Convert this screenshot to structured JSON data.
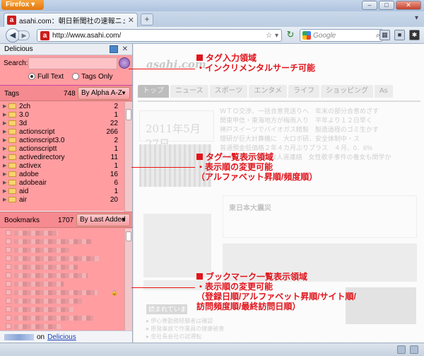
{
  "browser": {
    "menu_label": "Firefox",
    "tab_title": "asahi.com：朝日新聞社の速報ニュースサ...",
    "tab_favicon": "a",
    "new_tab": "+",
    "url": "http://www.asahi.com/",
    "search_placeholder": "Google",
    "window_buttons": [
      "–",
      "□",
      "✕"
    ]
  },
  "sidebar": {
    "title": "Delicious",
    "search": {
      "label": "Search:",
      "value": "",
      "options": [
        "Full Text",
        "Tags Only"
      ],
      "selected": "Full Text"
    },
    "tags": {
      "title": "Tags",
      "count": "748",
      "sort": "By Alpha A-Z",
      "items": [
        {
          "name": "2ch",
          "count": "2"
        },
        {
          "name": "3.0",
          "count": "1"
        },
        {
          "name": "3d",
          "count": "22"
        },
        {
          "name": "actionscript",
          "count": "266"
        },
        {
          "name": "actionscript3.0",
          "count": "2"
        },
        {
          "name": "actionscriptt",
          "count": "1"
        },
        {
          "name": "activedirectory",
          "count": "11"
        },
        {
          "name": "activex",
          "count": "1"
        },
        {
          "name": "adobe",
          "count": "16"
        },
        {
          "name": "adobeair",
          "count": "6"
        },
        {
          "name": "aid",
          "count": "1"
        },
        {
          "name": "air",
          "count": "20"
        }
      ]
    },
    "bookmarks": {
      "title": "Bookmarks",
      "count": "1707",
      "sort": "By Last Added",
      "row_widths": [
        62,
        110,
        78,
        120,
        90,
        104,
        70,
        118,
        96,
        84,
        112,
        66
      ]
    },
    "footer": {
      "on_text": "on",
      "link": "Delicious"
    }
  },
  "page": {
    "logo": "asahi.com",
    "nav": [
      "トップ",
      "ニュース",
      "スポーツ",
      "エンタメ",
      "ライフ",
      "ショッピング",
      "As"
    ],
    "date": "2011年5月27日",
    "headlines": [
      "ＷＴＯ交渉、一括合意見送りへ　年末の部分合意めざす",
      "関東甲信・東海地方が梅雨入り　平年より１２日早く",
      "神戸スイーツでバイオガス精製　製造過程のゴミ生かす",
      "理研が巨大計算機に　大ロボ研、安全体制中・ス",
      "普通預金低価格２年４カ月ぶりプラス　４月、0．6%",
      "アメリカの大規模な人道連絡　女性歌手事件の養女も関学か"
    ],
    "region_head": "東日本大震災",
    "bottom_label": "読まれています",
    "bottom_lines": [
      "▸ 伊心寮勤務経験者は確認",
      "▸ 原発事故で作業員の健康被害",
      "▸ 金社長会社の試運転"
    ]
  },
  "annotations": [
    {
      "title": "タグ入力領域",
      "lines": [
        "・インクリメンタルサーチ可能"
      ]
    },
    {
      "title": "タグ一覧表示領域",
      "lines": [
        "・表示順の変更可能",
        "（アルファベット昇順/頻度順）"
      ]
    },
    {
      "title": "ブックマーク一覧表示領域",
      "lines": [
        "・表示順の変更可能",
        "（登録日順/アルファベット昇順/サイト順/",
        "訪問頻度順/最終訪問日順）"
      ]
    }
  ],
  "colors": {
    "highlight_pink": "#ff9da1",
    "annotation_red": "#e0141c",
    "delicious_link": "#1a3fb8"
  }
}
